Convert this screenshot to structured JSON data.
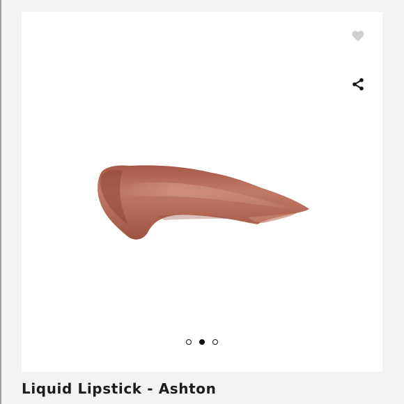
{
  "listing": {
    "title": "Liquid Lipstick - Ashton"
  },
  "actions": {
    "like_icon": "heart-icon",
    "share_icon": "share-icon"
  },
  "carousel": {
    "slide_count": 3,
    "active_index": 1
  },
  "colors": {
    "swatch": "#b86e5c",
    "heart_inactive": "#cfcfcf",
    "dot": "#111111"
  }
}
